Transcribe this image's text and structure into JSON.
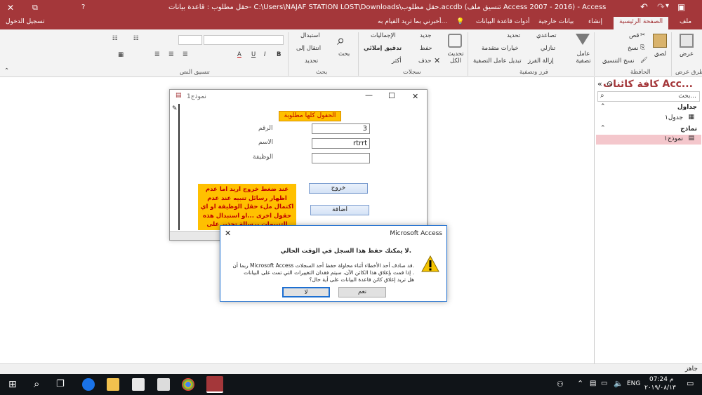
{
  "window": {
    "title": "حقل مطلوب : قاعدة بيانات- C:\\Users\\NAJAF STATION LOST\\Downloads\\حقل مطلوب.accdb (تنسيق ملف Access 2007 - 2016) - Access",
    "signin": "تسجيل الدخول",
    "close_glyph": "✕",
    "restore_glyph": "⧉",
    "help_glyph": "?"
  },
  "ribbon_tabs": [
    "ملف",
    "الصفحة الرئيسية",
    "إنشاء",
    "بيانات خارجية",
    "أدوات قاعدة البيانات",
    "أخبرني بما تريد القيام به..."
  ],
  "ribbon": {
    "view": "عرض",
    "views_group": "طرق عرض",
    "paste": "لصق",
    "cut": "قص",
    "copy": "نسخ",
    "format_painter": "نسخ التنسيق",
    "clipboard_group": "الحافظة",
    "filter": "عامل تصفية",
    "ascending": "تصاعدي",
    "descending": "تنازلي",
    "remove_sort": "إزالة الفرز",
    "selection": "تحديد",
    "advanced": "خيارات متقدمة",
    "toggle_filter": "تبديل عامل التصفية",
    "sort_filter_group": "فرز وتصفية",
    "refresh_all": "تحديث الكل",
    "new": "جديد",
    "save": "حفظ",
    "delete": "حذف",
    "totals": "الإجماليات",
    "spelling": "تدقيق إملائي",
    "more": "أكثر",
    "records_group": "سجلات",
    "find": "بحث",
    "replace": "استبدال",
    "goto": "انتقال إلى",
    "select": "تحديد",
    "find_group": "بحث",
    "text_format_group": "تنسيق النص",
    "bold": "B",
    "italic": "I",
    "underline": "U",
    "font_color": "A"
  },
  "nav_pane": {
    "title": "كافة كائنات Acc...",
    "search_placeholder": "بحث...",
    "sections": [
      {
        "header": "جداول",
        "items": [
          "جدول١"
        ]
      },
      {
        "header": "نماذج",
        "items": [
          "نموذج١"
        ]
      }
    ]
  },
  "form": {
    "title": "نموذج1",
    "banner": "الحقول كلها مطلوبة",
    "fields": [
      {
        "label": "الرقم",
        "value": "3"
      },
      {
        "label": "الاسم",
        "value": "rtrrt"
      },
      {
        "label": "الوظيفة",
        "value": ""
      }
    ],
    "exit_button": "خروج",
    "add_button": "اضافة",
    "note": "عند ضغط خروج اريد اما عدم اظهار رسائل تنبيه عند عدم اكتمال ملء حقل الوظيفة او اي حقول اخرى ...او استبدال هذه التنبيهات برسالة تحذير على اكمال الاملاء"
  },
  "dialog": {
    "title": "Microsoft Access",
    "heading": "لا يمكنك حفظ هذا السجل في الوقت الحالي.",
    "line1": "ربما أن Microsoft Access قد صادف أحد الأخطاء أثناء محاولة حفظ أحد السجلات.",
    "line2": "إذا قمت بإغلاق هذا الكائن الآن، سيتم فقدان التغييرات التي تمت على البيانات .",
    "line3": "هل تريد إغلاق كائن قاعدة البيانات على أية حال؟",
    "yes": "نعم",
    "no": "لا"
  },
  "status": {
    "text": "جاهز"
  },
  "taskbar": {
    "time": "07:24 م",
    "date": "٢٠١٩/٠٨/١٣",
    "lang": "ENG"
  },
  "colors": {
    "accent": "#a4373a",
    "note_bg": "#ffc000",
    "banner_bg": "#ffc000"
  }
}
